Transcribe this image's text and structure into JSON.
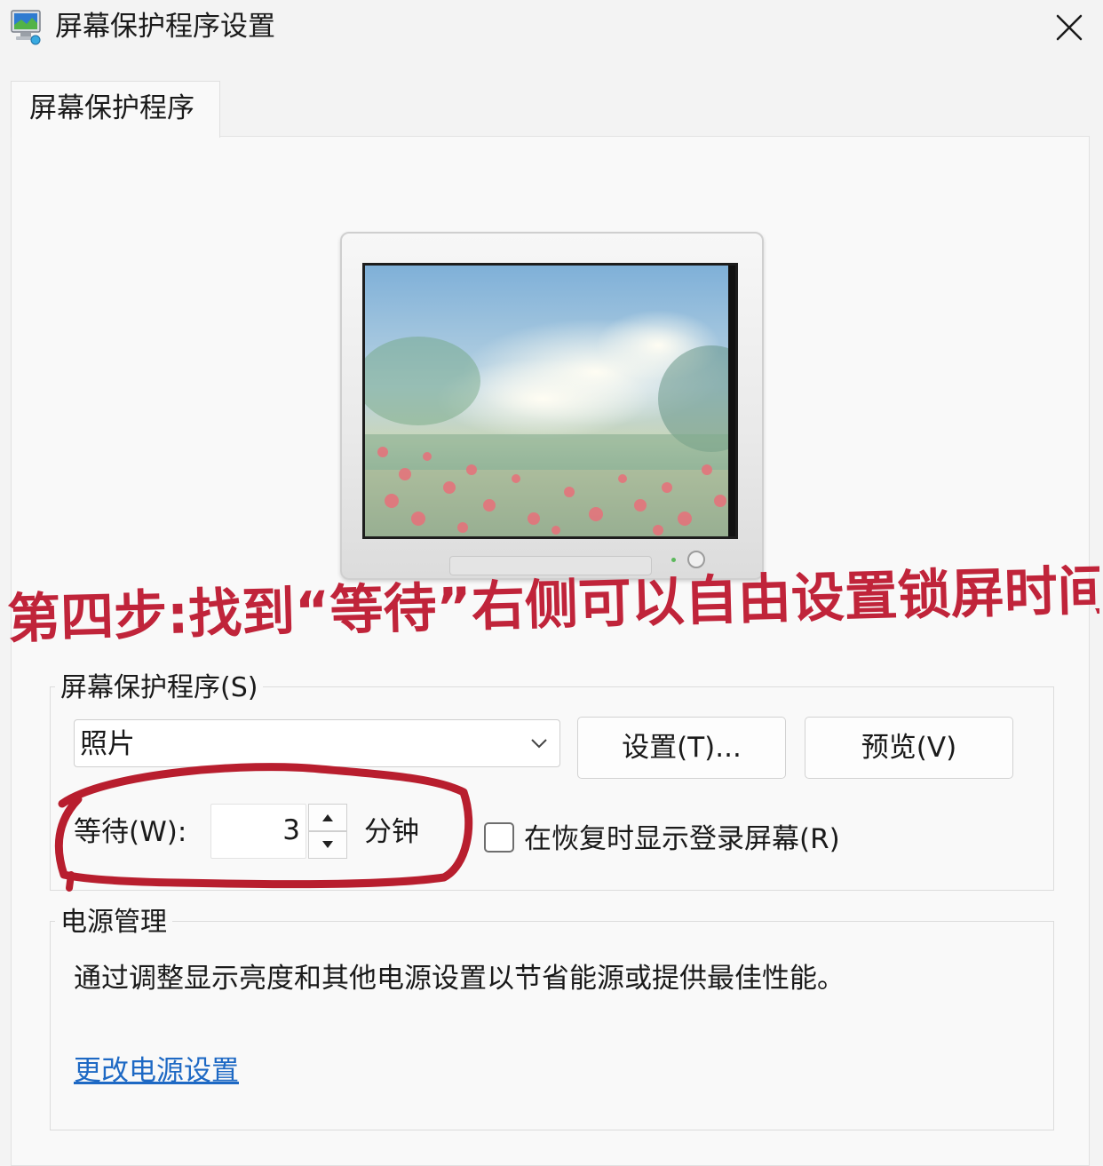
{
  "window": {
    "title": "屏幕保护程序设置",
    "close_icon": "close-icon"
  },
  "tab": {
    "label": "屏幕保护程序"
  },
  "annotation": {
    "text": "第四步:找到“等待”右侧可以自由设置锁屏时间",
    "color": "#c0243a"
  },
  "screensaver": {
    "group_label": "屏幕保护程序(S)",
    "selected": "照片",
    "settings_button": "设置(T)...",
    "preview_button": "预览(V)",
    "wait_label": "等待(W):",
    "wait_value": "3",
    "minutes_label": "分钟",
    "resume_checkbox_label": "在恢复时显示登录屏幕(R)",
    "resume_checked": false
  },
  "power": {
    "group_label": "电源管理",
    "description": "通过调整显示亮度和其他电源设置以节省能源或提供最佳性能。",
    "link": "更改电源设置"
  },
  "colors": {
    "link": "#1e69c4",
    "annotation": "#c0243a",
    "background": "#f3f3f3"
  }
}
